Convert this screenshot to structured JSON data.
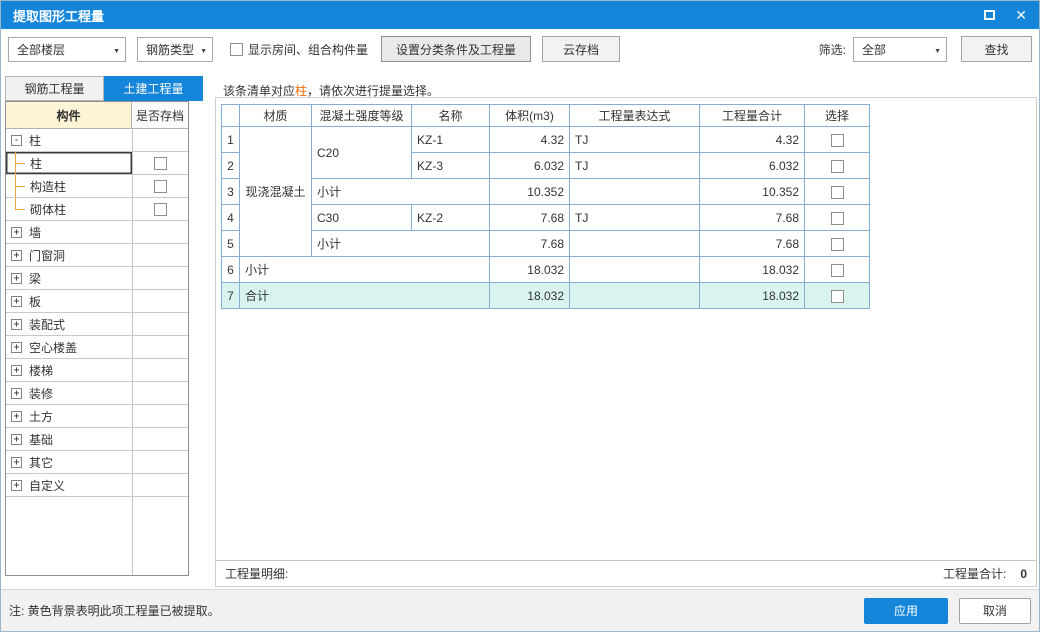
{
  "window": {
    "title": "提取图形工程量"
  },
  "toolbar": {
    "floor_select": "全部楼层",
    "rebar_select": "钢筋类型",
    "show_room_label": "显示房间、组合构件量",
    "set_category_button": "设置分类条件及工程量",
    "cloud_save_button": "云存档",
    "filter_label": "筛选:",
    "filter_select": "全部",
    "find_button": "查找"
  },
  "tabs": {
    "rebar": "钢筋工程量",
    "civil": "土建工程量"
  },
  "hint": {
    "prefix": "该条清单对应",
    "highlight": "柱",
    "suffix": "，请依次进行提量选择。"
  },
  "tree": {
    "header_component": "构件",
    "header_archive": "是否存档",
    "items": [
      {
        "label": "柱"
      },
      {
        "label": "柱"
      },
      {
        "label": "构造柱"
      },
      {
        "label": "砌体柱"
      },
      {
        "label": "墙"
      },
      {
        "label": "门窗洞"
      },
      {
        "label": "梁"
      },
      {
        "label": "板"
      },
      {
        "label": "装配式"
      },
      {
        "label": "空心楼盖"
      },
      {
        "label": "楼梯"
      },
      {
        "label": "装修"
      },
      {
        "label": "土方"
      },
      {
        "label": "基础"
      },
      {
        "label": "其它"
      },
      {
        "label": "自定义"
      }
    ]
  },
  "table": {
    "headers": {
      "material": "材质",
      "grade": "混凝土强度等级",
      "name": "名称",
      "volume": "体积(m3)",
      "expression": "工程量表达式",
      "total": "工程量合计",
      "select": "选择"
    },
    "material": "现浇混凝土",
    "rows": {
      "r1": {
        "num": "1",
        "grade": "C20",
        "name": "KZ-1",
        "volume": "4.32",
        "expression": "TJ",
        "total": "4.32"
      },
      "r2": {
        "num": "2",
        "name": "KZ-3",
        "volume": "6.032",
        "expression": "TJ",
        "total": "6.032"
      },
      "r3": {
        "num": "3",
        "label": "小计",
        "volume": "10.352",
        "total": "10.352"
      },
      "r4": {
        "num": "4",
        "grade": "C30",
        "name": "KZ-2",
        "volume": "7.68",
        "expression": "TJ",
        "total": "7.68"
      },
      "r5": {
        "num": "5",
        "label": "小计",
        "volume": "7.68",
        "total": "7.68"
      },
      "r6": {
        "num": "6",
        "label": "小计",
        "volume": "18.032",
        "total": "18.032"
      },
      "r7": {
        "num": "7",
        "label": "合计",
        "volume": "18.032",
        "total": "18.032"
      }
    }
  },
  "footer": {
    "detail_label": "工程量明细:",
    "total_label": "工程量合计:",
    "total_value": "0"
  },
  "bottom": {
    "note": "注: 黄色背景表明此项工程量已被提取。",
    "apply": "应用",
    "cancel": "取消"
  },
  "colors": {
    "titlebar": "#1485d9",
    "accent": "#1485d9",
    "tree_header_bg": "#fdf3d7",
    "total_row_bg": "#d9f3ef",
    "table_border": "#85aed0",
    "hint_highlight": "#ff6a00",
    "tree_connector": "#efa23d"
  }
}
